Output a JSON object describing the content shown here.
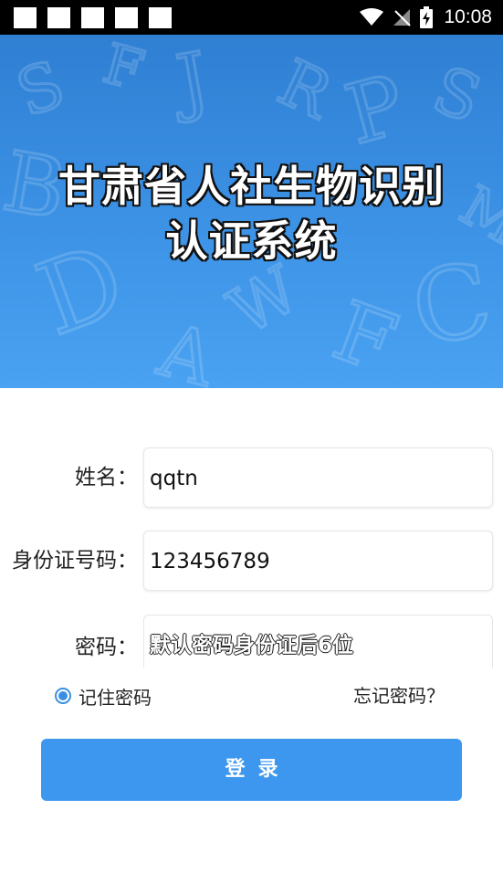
{
  "status_bar": {
    "time": "10:08",
    "notification_count": 5,
    "icons": [
      "wifi-icon",
      "no-signal-icon",
      "battery-charging-icon"
    ]
  },
  "banner": {
    "title_line1": "甘肃省人社生物识别",
    "title_line2": "认证系统",
    "gradient_colors": [
      "#2f7fd3",
      "#4aa2f2"
    ]
  },
  "form": {
    "name_label": "姓名：",
    "name_value": "qqtn",
    "id_label": "身份证号码：",
    "id_value": "123456789",
    "password_label": "密码：",
    "password_placeholder": "默认密码身份证后6位"
  },
  "options": {
    "remember_label": "记住密码",
    "remember_checked": true,
    "forgot_label": "忘记密码？"
  },
  "login_button": {
    "label": "登录",
    "color": "#3d97ee"
  }
}
